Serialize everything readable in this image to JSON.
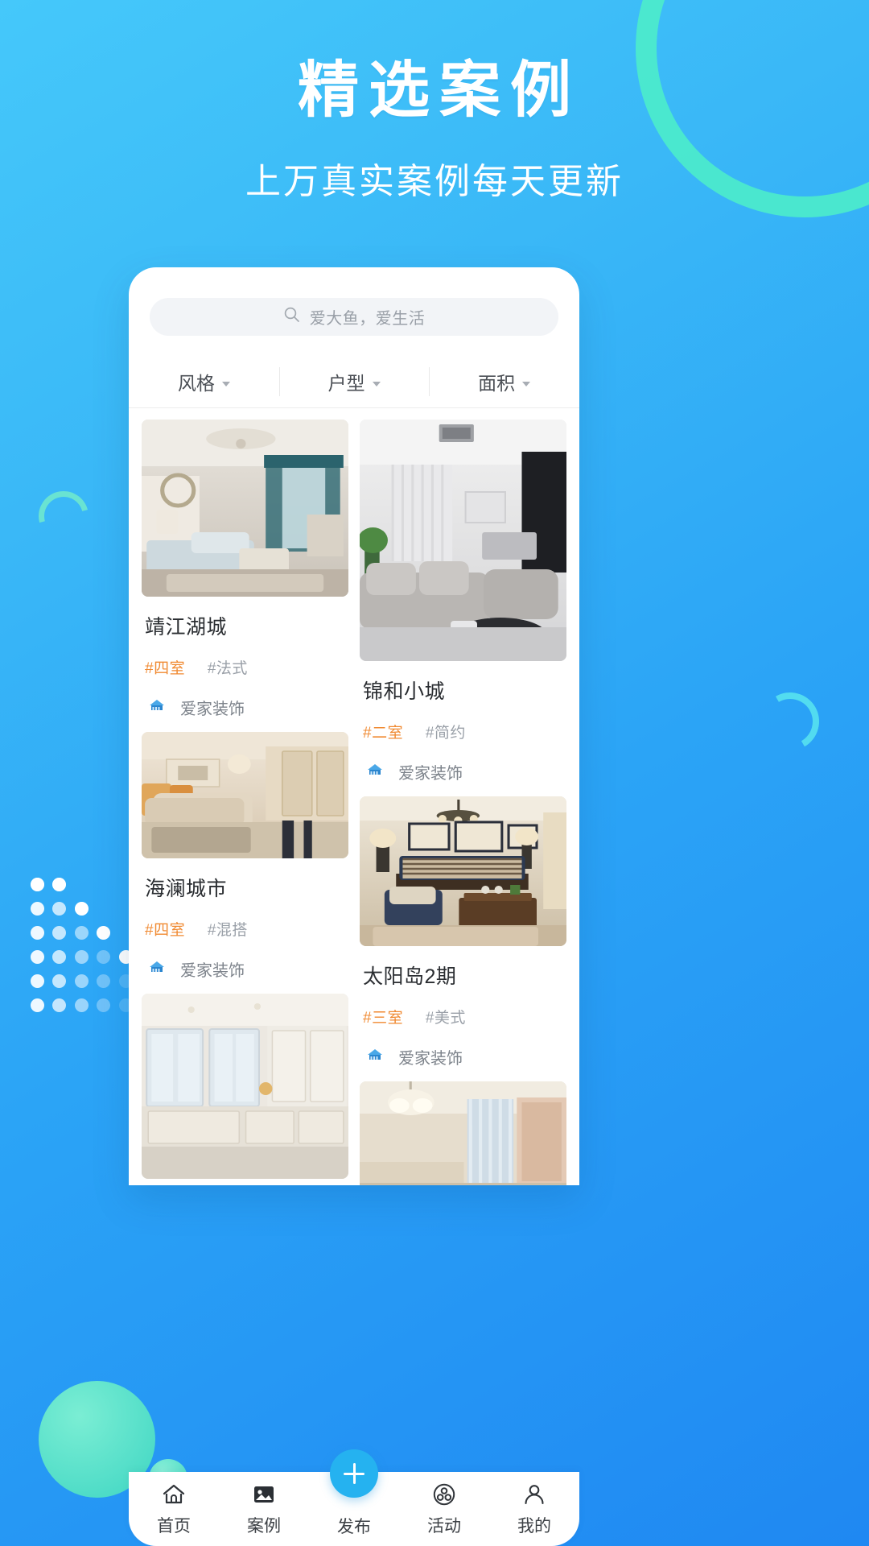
{
  "promo": {
    "title": "精选案例",
    "subtitle": "上万真实案例每天更新"
  },
  "colors": {
    "bg_start": "#45c8fa",
    "bg_end": "#1f88f2",
    "accent_orange": "#f08a32",
    "accent_blue": "#25b2f0",
    "teal": "#4ef0c8"
  },
  "app": {
    "search": {
      "placeholder": "爱大鱼，爱生活",
      "icon": "search-icon"
    },
    "filters": [
      {
        "label": "风格",
        "icon": "chevron-down-icon"
      },
      {
        "label": "户型",
        "icon": "chevron-down-icon"
      },
      {
        "label": "面积",
        "icon": "chevron-down-icon"
      }
    ],
    "cards_left": [
      {
        "title": "靖江湖城",
        "tag_room": "#四室",
        "tag_style": "#法式",
        "shop": "爱家装饰",
        "shop_icon": "shop-house-icon",
        "image_alt": "french-style-living-room"
      },
      {
        "title": "海澜城市",
        "tag_room": "#四室",
        "tag_style": "#混搭",
        "shop": "爱家装饰",
        "shop_icon": "shop-house-icon",
        "image_alt": "mixed-style-living-room"
      },
      {
        "title": "",
        "tag_room": "",
        "tag_style": "",
        "shop": "",
        "shop_icon": "",
        "image_alt": "white-cabinet-kitchen"
      }
    ],
    "cards_right": [
      {
        "title": "锦和小城",
        "tag_room": "#二室",
        "tag_style": "#简约",
        "shop": "爱家装饰",
        "shop_icon": "shop-house-icon",
        "image_alt": "minimal-grey-living-room"
      },
      {
        "title": "太阳岛2期",
        "tag_room": "#三室",
        "tag_style": "#美式",
        "shop": "爱家装饰",
        "shop_icon": "shop-house-icon",
        "image_alt": "american-style-living-room"
      },
      {
        "title": "",
        "tag_room": "",
        "tag_style": "",
        "shop": "",
        "shop_icon": "",
        "image_alt": "bedroom-with-chandelier"
      }
    ],
    "tabbar": [
      {
        "label": "首页",
        "icon": "home-icon"
      },
      {
        "label": "案例",
        "icon": "image-icon"
      },
      {
        "label": "发布",
        "icon": "plus-icon"
      },
      {
        "label": "活动",
        "icon": "activity-circles-icon"
      },
      {
        "label": "我的",
        "icon": "person-icon"
      }
    ]
  }
}
